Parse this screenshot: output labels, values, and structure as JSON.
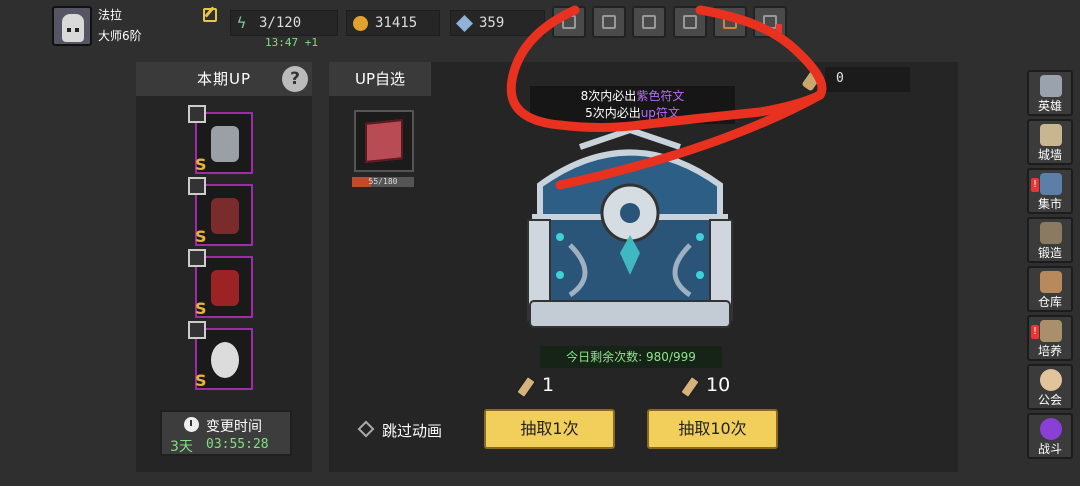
{
  "player": {
    "name": "法拉",
    "rank": "大师6阶"
  },
  "resources": {
    "energy": "3/120",
    "energy_timer": "13:47 +1",
    "gold": "31415",
    "gems": "359"
  },
  "top_buttons": [
    "bag-icon",
    "mail-icon",
    "gamepad-icon",
    "gift-icon",
    "shop-icon",
    "quest-icon"
  ],
  "left_panel": {
    "title": "本期UP",
    "help": "?",
    "grade_label": "S",
    "change_time_label": "变更时间",
    "days": "3天",
    "countdown": "03:55:28"
  },
  "main_panel": {
    "title": "UP自选",
    "pick_progress_text": "55/180",
    "pick_progress": 0.3056,
    "notice_line1_prefix": "8次内必出",
    "notice_line1_highlight": "紫色符文",
    "notice_line2_prefix": "5次内必出",
    "notice_line2_highlight": "up符文",
    "scroll_count": "0",
    "remaining": "今日剩余次数: 980/999",
    "cost_single": "1",
    "cost_ten": "10",
    "skip_label": "跳过动画",
    "draw1_label": "抽取1次",
    "draw10_label": "抽取10次"
  },
  "nav": [
    {
      "label": "英雄",
      "icon": "helmet-icon"
    },
    {
      "label": "城墙",
      "icon": "wall-icon"
    },
    {
      "label": "集市",
      "icon": "market-icon"
    },
    {
      "label": "锻造",
      "icon": "anvil-icon"
    },
    {
      "label": "仓库",
      "icon": "warehouse-icon"
    },
    {
      "label": "培养",
      "icon": "training-icon"
    },
    {
      "label": "公会",
      "icon": "guild-icon"
    },
    {
      "label": "战斗",
      "icon": "portal-icon"
    }
  ],
  "colors": {
    "purple_card": "#a12aa8",
    "draw_button": "#f2cf5b",
    "annotation": "#e8321f"
  }
}
